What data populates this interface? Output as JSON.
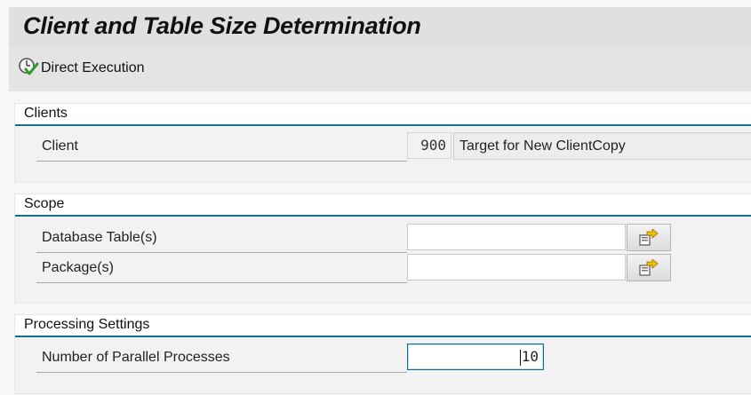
{
  "title": "Client and Table Size Determination",
  "toolbar": {
    "direct_execution": "Direct Execution"
  },
  "clients": {
    "header": "Clients",
    "client_label": "Client",
    "client_value": "900",
    "client_description": "Target for New ClientCopy"
  },
  "scope": {
    "header": "Scope",
    "db_tables_label": "Database Table(s)",
    "db_tables_value": "",
    "packages_label": "Package(s)",
    "packages_value": ""
  },
  "processing": {
    "header": "Processing Settings",
    "parallel_label": "Number of Parallel Processes",
    "parallel_value": "10"
  },
  "colors": {
    "section_rule": "#15728c",
    "title_bg": "#e0e0e0"
  }
}
